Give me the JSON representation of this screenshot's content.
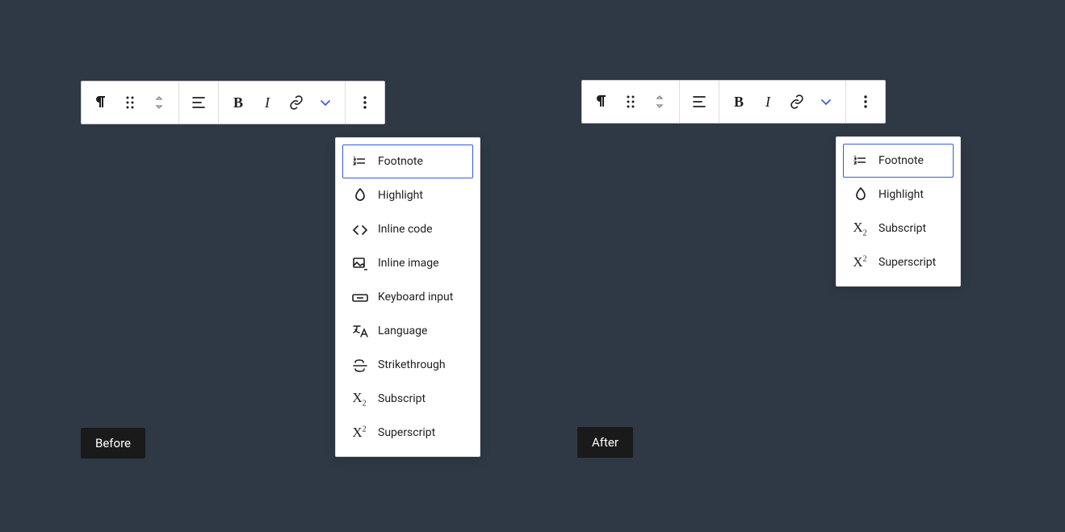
{
  "badges": {
    "before": "Before",
    "after": "After"
  },
  "menu": {
    "footnote": "Footnote",
    "highlight": "Highlight",
    "inline_code": "Inline code",
    "inline_image": "Inline image",
    "keyboard_input": "Keyboard input",
    "language": "Language",
    "strikethrough": "Strikethrough",
    "subscript": "Subscript",
    "superscript": "Superscript"
  }
}
